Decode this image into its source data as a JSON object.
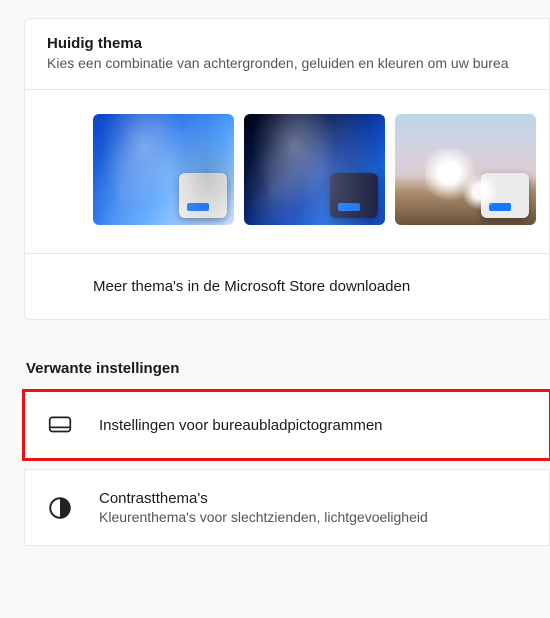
{
  "theme_card": {
    "title": "Huidig thema",
    "subtitle": "Kies een combinatie van achtergronden, geluiden en kleuren om uw burea"
  },
  "themes": [
    {
      "style": "blue-light",
      "mini": "light",
      "name": "theme-windows-light"
    },
    {
      "style": "blue-dark",
      "mini": "dark",
      "name": "theme-windows-dark"
    },
    {
      "style": "landscape",
      "mini": "light",
      "name": "theme-sunrise-photo"
    }
  ],
  "store_row": "Meer thema's in de Microsoft Store downloaden",
  "related": {
    "heading": "Verwante instellingen",
    "rows": [
      {
        "icon": "monitor",
        "title": "Instellingen voor bureaubladpictogrammen",
        "subtitle": "",
        "highlight": true
      },
      {
        "icon": "contrast",
        "title": "Contrastthema's",
        "subtitle": "Kleurenthema's voor slechtzienden, lichtgevoeligheid"
      }
    ]
  }
}
